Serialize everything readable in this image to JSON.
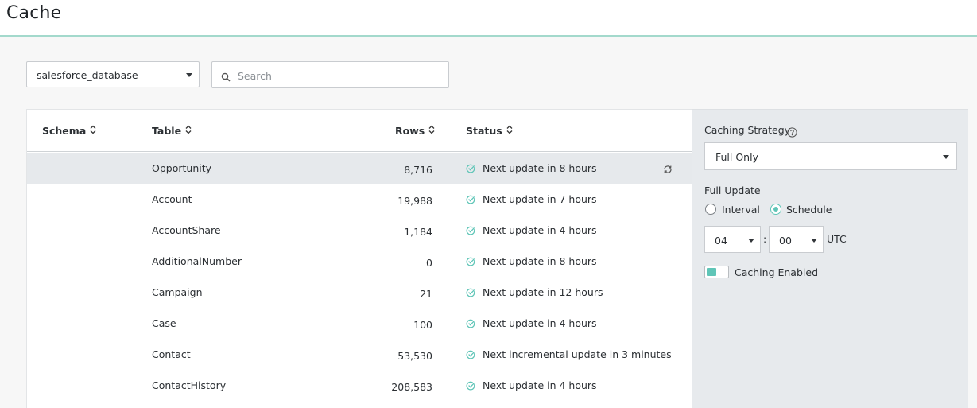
{
  "page": {
    "title": "Cache"
  },
  "database_select": {
    "value": "salesforce_database"
  },
  "search": {
    "placeholder": "Search",
    "value": ""
  },
  "table": {
    "columns": {
      "schema": "Schema",
      "table": "Table",
      "rows": "Rows",
      "status": "Status"
    },
    "rows": [
      {
        "schema": "",
        "table": "Opportunity",
        "rows": "8,716",
        "status": "Next update in 8 hours",
        "selected": true
      },
      {
        "schema": "",
        "table": "Account",
        "rows": "19,988",
        "status": "Next update in 7 hours",
        "selected": false
      },
      {
        "schema": "",
        "table": "AccountShare",
        "rows": "1,184",
        "status": "Next update in 4 hours",
        "selected": false
      },
      {
        "schema": "",
        "table": "AdditionalNumber",
        "rows": "0",
        "status": "Next update in 8 hours",
        "selected": false
      },
      {
        "schema": "",
        "table": "Campaign",
        "rows": "21",
        "status": "Next update in 12 hours",
        "selected": false
      },
      {
        "schema": "",
        "table": "Case",
        "rows": "100",
        "status": "Next update in 4 hours",
        "selected": false
      },
      {
        "schema": "",
        "table": "Contact",
        "rows": "53,530",
        "status": "Next incremental update in 3 minutes",
        "selected": false
      },
      {
        "schema": "",
        "table": "ContactHistory",
        "rows": "208,583",
        "status": "Next update in 4 hours",
        "selected": false
      }
    ]
  },
  "settings": {
    "caching_strategy_label": "Caching Strategy",
    "caching_strategy_value": "Full Only",
    "full_update_label": "Full Update",
    "interval_label": "Interval",
    "schedule_label": "Schedule",
    "selected_mode": "Schedule",
    "hour_value": "04",
    "separator": ":",
    "minute_value": "00",
    "timezone": "UTC",
    "caching_enabled_label": "Caching Enabled",
    "caching_enabled": true
  },
  "colors": {
    "accent": "#5fc5b7",
    "header_border": "#a3d9cc",
    "selected_row": "#e6e9ec",
    "side_panel": "#e7eaed"
  },
  "icons": {
    "status": "check-circle-icon",
    "refresh": "refresh-icon",
    "search": "search-icon",
    "help": "help-icon",
    "sort": "sort-icon"
  }
}
